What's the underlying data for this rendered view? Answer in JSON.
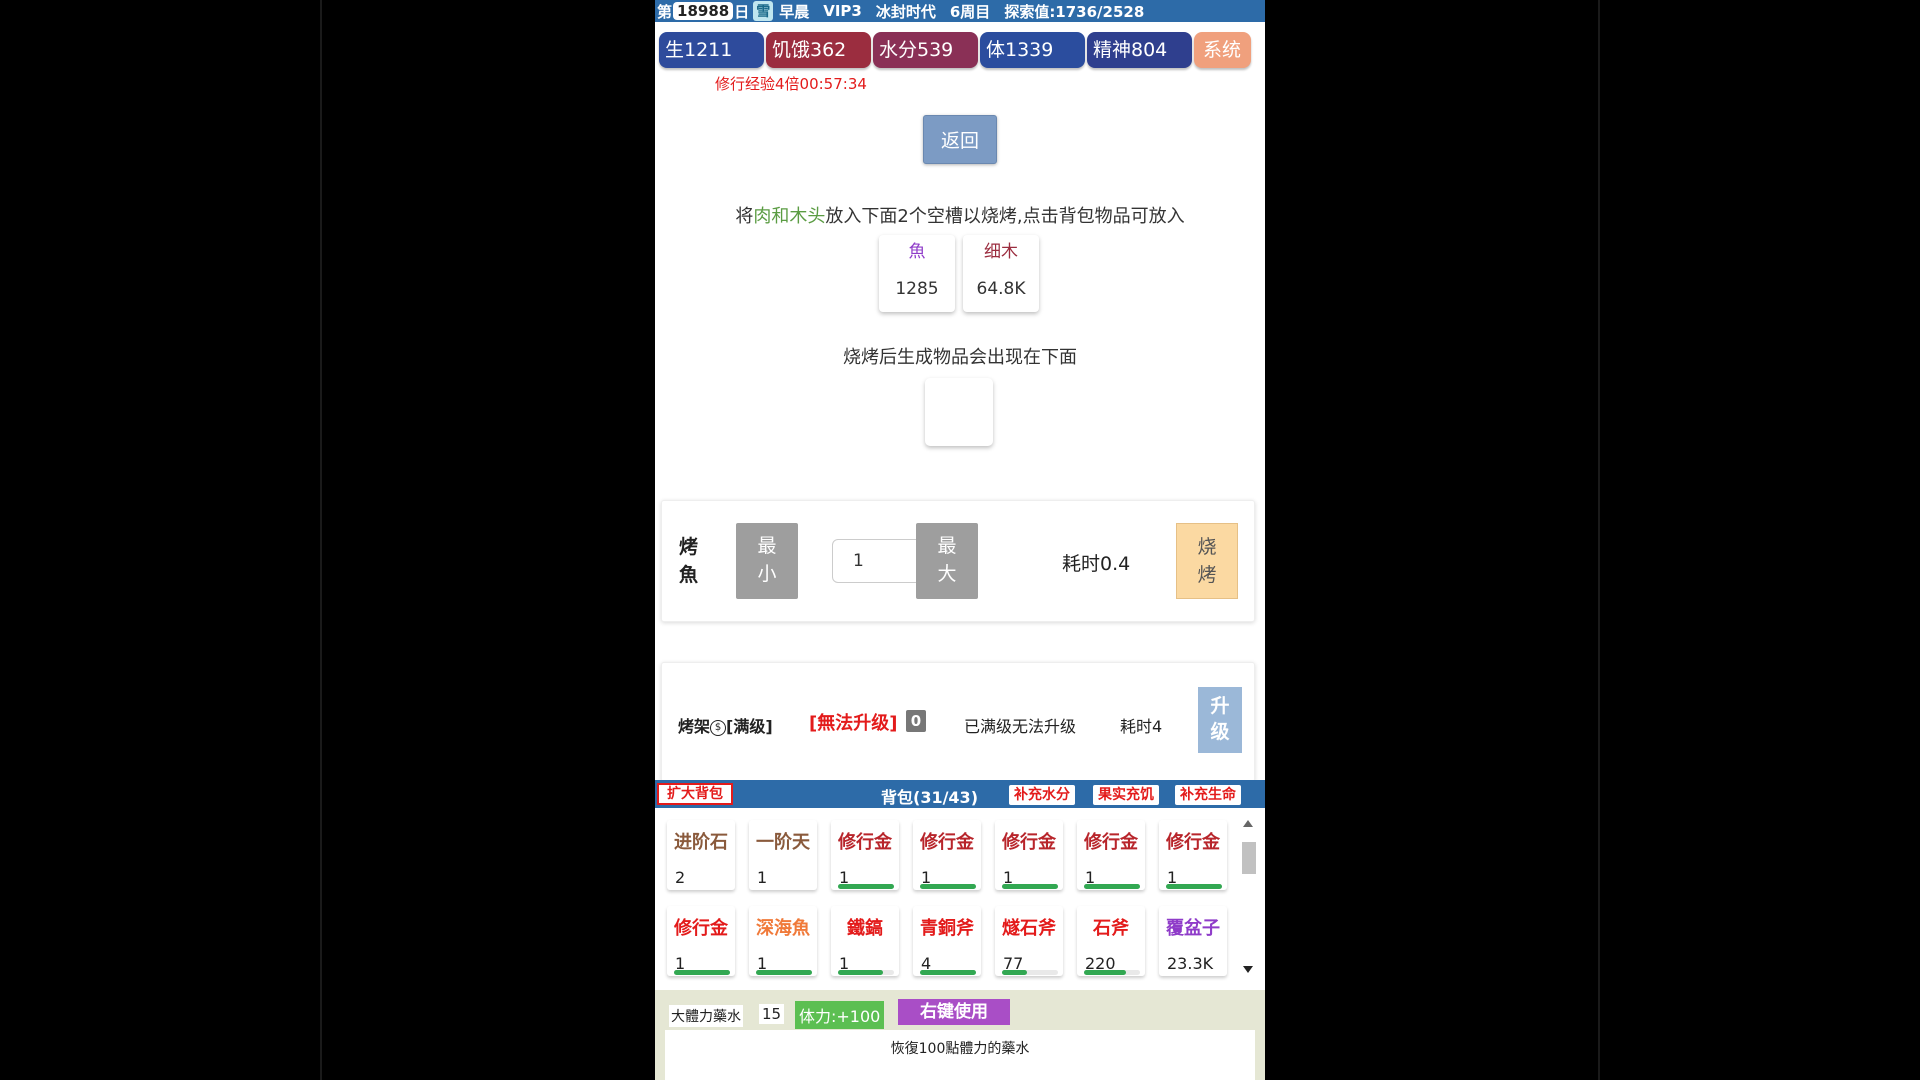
{
  "topbar": {
    "day_prefix": "第",
    "day_value": "18988",
    "day_suffix": "日",
    "weather": "雪",
    "time_of_day": "早晨",
    "vip": "VIP3",
    "era": "冰封时代",
    "week": "6周目",
    "explore": "探索值:1736/2528"
  },
  "stats": {
    "life": "生1211",
    "hunger": "饥饿362",
    "water": "水分539",
    "stamina": "体1339",
    "spirit": "精神804",
    "system": "系统"
  },
  "exp_bonus": "修行经验4倍00:57:34",
  "back_label": "返回",
  "instructions": {
    "pre": "将",
    "highlight": "肉和木头",
    "post": "放入下面2个空槽以烧烤,点击背包物品可放入"
  },
  "slots": [
    {
      "name": "魚",
      "qty": "1285"
    },
    {
      "name": "细木",
      "qty": "64.8K"
    }
  ],
  "after_text": "烧烤后生成物品会出现在下面",
  "roast": {
    "label": "烤魚",
    "min_label": "最小",
    "quantity": "1",
    "max_label": "最大",
    "time": "耗时0.4",
    "roast_label": "烧烤"
  },
  "grill": {
    "name": "烤架",
    "coin_icon": "$",
    "level": "[满级]",
    "cant_upgrade": "[無法升级]",
    "badge": "0",
    "maxed_text": "已满级无法升级",
    "time": "耗时4",
    "upgrade_label": "升级"
  },
  "bag": {
    "expand_label": "扩大背包",
    "title": "背包(31/43)",
    "actions": [
      "补充水分",
      "果实充饥",
      "补充生命"
    ]
  },
  "items": [
    {
      "name": "进阶石",
      "qty": "2",
      "color": "#8a5a3c",
      "bar": 0
    },
    {
      "name": "一阶天",
      "qty": "1",
      "color": "#8a5a3c",
      "bar": 0
    },
    {
      "name": "修行金",
      "qty": "1",
      "color": "#b8252b",
      "bar": 1
    },
    {
      "name": "修行金",
      "qty": "1",
      "color": "#b8252b",
      "bar": 1
    },
    {
      "name": "修行金",
      "qty": "1",
      "color": "#b8252b",
      "bar": 1
    },
    {
      "name": "修行金",
      "qty": "1",
      "color": "#b8252b",
      "bar": 1
    },
    {
      "name": "修行金",
      "qty": "1",
      "color": "#b8252b",
      "bar": 1
    },
    {
      "name": "修行金",
      "qty": "1",
      "color": "#e31b1b",
      "bar": 1
    },
    {
      "name": "深海魚",
      "qty": "1",
      "color": "#f07a3a",
      "bar": 1
    },
    {
      "name": "鐵鎬",
      "qty": "1",
      "color": "#e31b1b",
      "bar": 0.8
    },
    {
      "name": "青銅斧",
      "qty": "4",
      "color": "#e31b1b",
      "bar": 1
    },
    {
      "name": "燧石斧",
      "qty": "77",
      "color": "#e31b1b",
      "bar": 0.45
    },
    {
      "name": "石斧",
      "qty": "220",
      "color": "#e31b1b",
      "bar": 0.75
    },
    {
      "name": "覆盆子",
      "qty": "23.3K",
      "color": "#8f3cc9",
      "bar": 0
    }
  ],
  "detail": {
    "name": "大體力藥水",
    "qty": "15",
    "effect": "体力:+100",
    "use_label": "右键使用",
    "description": "恢復100點體力的藥水"
  }
}
